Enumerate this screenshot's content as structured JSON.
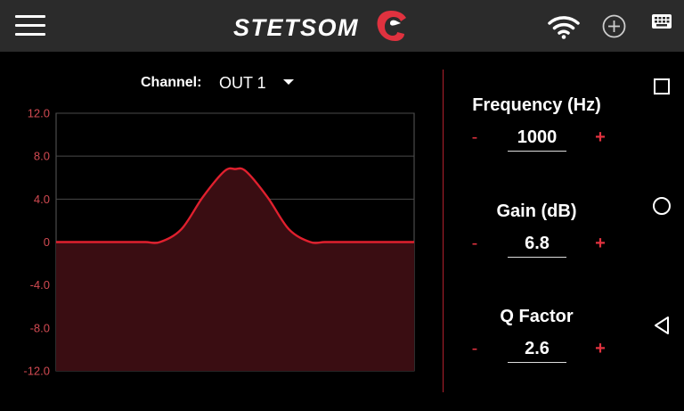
{
  "app": {
    "brand": "STETSOM",
    "colors": {
      "accent": "#e0323f",
      "bar": "#2b2b2b",
      "background": "#000000"
    }
  },
  "icons": {
    "menu": "menu-icon",
    "wifi": "wifi-icon",
    "add": "add-circle-icon",
    "keyboard": "keyboard-icon",
    "recents": "square-icon",
    "home": "circle-icon",
    "back": "triangle-back-icon"
  },
  "channel": {
    "label": "Channel:",
    "value": "OUT 1"
  },
  "chart_data": {
    "type": "area",
    "ylim": [
      -12,
      12
    ],
    "yticks": [
      "12.0",
      "8.0",
      "4.0",
      "0",
      "-4.0",
      "-8.0",
      "-12.0"
    ],
    "x": [
      0,
      0.1,
      0.2,
      0.25,
      0.29,
      0.35,
      0.41,
      0.47,
      0.5,
      0.53,
      0.59,
      0.65,
      0.71,
      0.75,
      0.8,
      0.9,
      1.0
    ],
    "values": [
      0,
      0,
      0,
      0,
      0,
      1.2,
      4.2,
      6.6,
      6.8,
      6.6,
      4.2,
      1.2,
      0,
      0,
      0,
      0,
      0
    ]
  },
  "params": {
    "frequency": {
      "title": "Frequency (Hz)",
      "value": "1000",
      "minus": "-",
      "plus": "+"
    },
    "gain": {
      "title": "Gain (dB)",
      "value": "6.8",
      "minus": "-",
      "plus": "+"
    },
    "q": {
      "title": "Q Factor",
      "value": "2.6",
      "minus": "-",
      "plus": "+"
    }
  }
}
